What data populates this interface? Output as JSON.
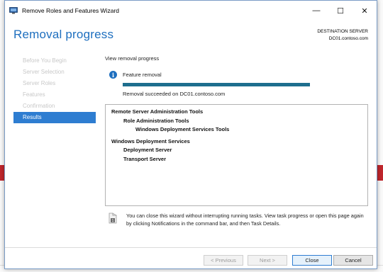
{
  "window": {
    "title": "Remove Roles and Features Wizard",
    "controls": {
      "minimize": "—",
      "maximize": "☐",
      "close": "✕"
    }
  },
  "header": {
    "heading": "Removal progress",
    "destination_label": "DESTINATION SERVER",
    "destination_value": "DC01.contoso.com"
  },
  "nav": {
    "items": [
      {
        "label": "Before You Begin",
        "active": false
      },
      {
        "label": "Server Selection",
        "active": false
      },
      {
        "label": "Server Roles",
        "active": false
      },
      {
        "label": "Features",
        "active": false
      },
      {
        "label": "Confirmation",
        "active": false
      },
      {
        "label": "Results",
        "active": true
      }
    ]
  },
  "main": {
    "view_label": "View removal progress",
    "feature_label": "Feature removal",
    "progress": 1.0,
    "success_text": "Removal succeeded on DC01.contoso.com",
    "results": [
      {
        "text": "Remote Server Administration Tools",
        "level": 0
      },
      {
        "text": "Role Administration Tools",
        "level": 1
      },
      {
        "text": "Windows Deployment Services Tools",
        "level": 2
      },
      {
        "text": "Windows Deployment Services",
        "level": 0
      },
      {
        "text": "Deployment Server",
        "level": 1
      },
      {
        "text": "Transport Server",
        "level": 1
      }
    ],
    "notice_text": "You can close this wizard without interrupting running tasks. View task progress or open this page again by clicking Notifications in the command bar, and then Task Details."
  },
  "footer": {
    "previous": "< Previous",
    "next": "Next >",
    "close": "Close",
    "cancel": "Cancel"
  },
  "colors": {
    "accent": "#1e6fbf",
    "nav_active": "#2e7dd1",
    "progress": "#1e6e8e",
    "background_banner": "#c0262c"
  }
}
